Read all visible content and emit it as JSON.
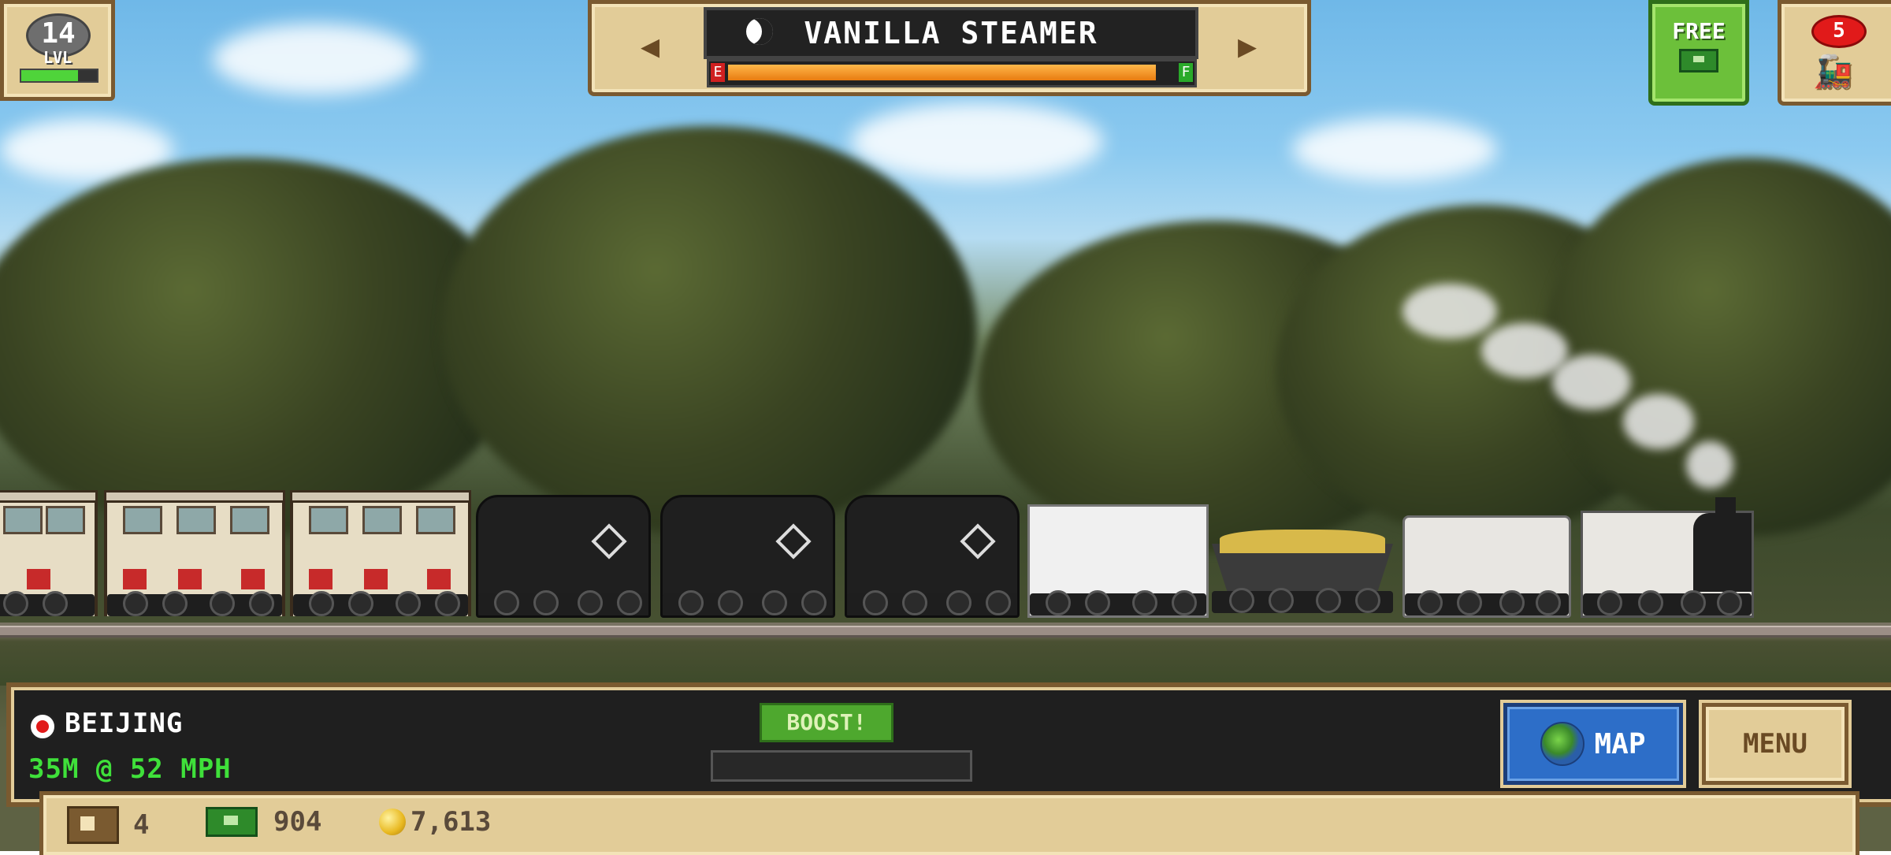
{
  "hud": {
    "level": {
      "number": "14",
      "label": "LVL",
      "progress": 0.75
    },
    "train_selector": {
      "prev_icon": "left-arrow-icon",
      "next_icon": "right-arrow-icon",
      "name": "VANILLA STEAMER",
      "fuel_empty_label": "E",
      "fuel_full_label": "F",
      "fuel_level": 0.97
    },
    "free_button": {
      "label": "FREE",
      "icon": "cash-icon"
    },
    "trains_button": {
      "badge": "5",
      "icon": "train-icon"
    }
  },
  "panel": {
    "station": "BEIJING",
    "speed_text": "35M @ 52 MPH",
    "boost_label": "BOOST!",
    "boost_progress": 0,
    "map_label": "MAP",
    "menu_label": "MENU"
  },
  "resources": {
    "crates": "4",
    "cash": "904",
    "coins": "7,613"
  },
  "colors": {
    "accent_green": "#4ea82e",
    "panel_tan": "#e2cc98",
    "speed_green": "#3fe03a",
    "fuel_orange": "#e87b10"
  }
}
